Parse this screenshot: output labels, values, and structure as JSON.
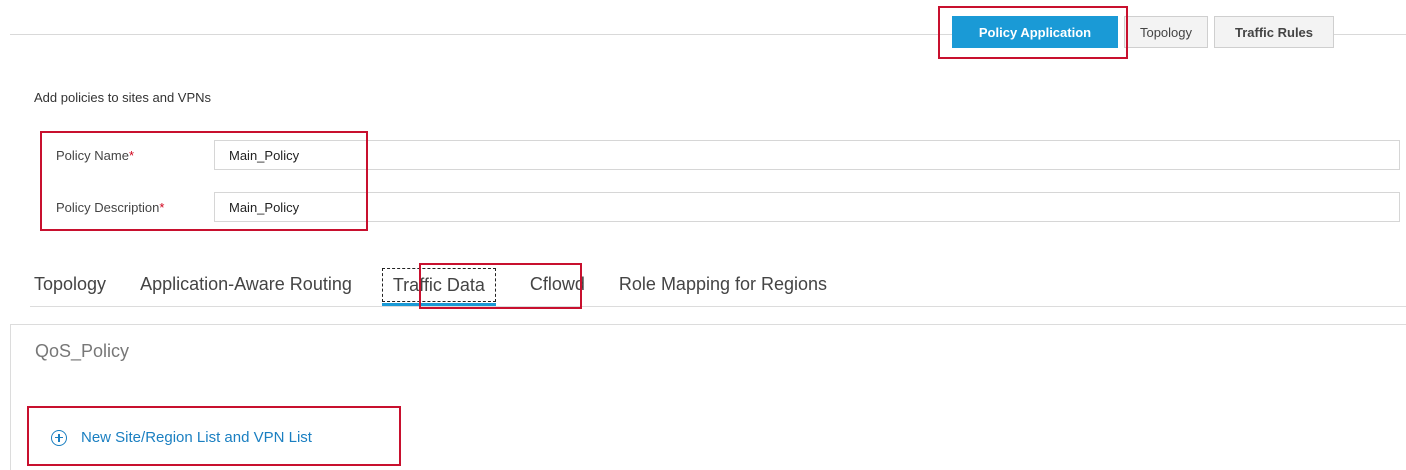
{
  "top_tabs": {
    "policy_application": "Policy Application",
    "topology": "Topology",
    "traffic_rules": "Traffic Rules"
  },
  "subtitle": "Add policies to sites and VPNs",
  "form": {
    "policy_name_label": "Policy Name",
    "policy_name_value": "Main_Policy",
    "policy_description_label": "Policy Description",
    "policy_description_value": "Main_Policy",
    "required_mark": "*"
  },
  "sub_tabs": {
    "topology": "Topology",
    "app_aware_routing": "Application-Aware Routing",
    "traffic_data": "Traffic Data",
    "cflowd": "Cflowd",
    "role_mapping": "Role Mapping for Regions"
  },
  "panel": {
    "title": "QoS_Policy",
    "add_link": "New Site/Region List and VPN List"
  },
  "colors": {
    "accent": "#1a9ad6",
    "highlight": "#c8102e",
    "link": "#1a7fc1"
  }
}
